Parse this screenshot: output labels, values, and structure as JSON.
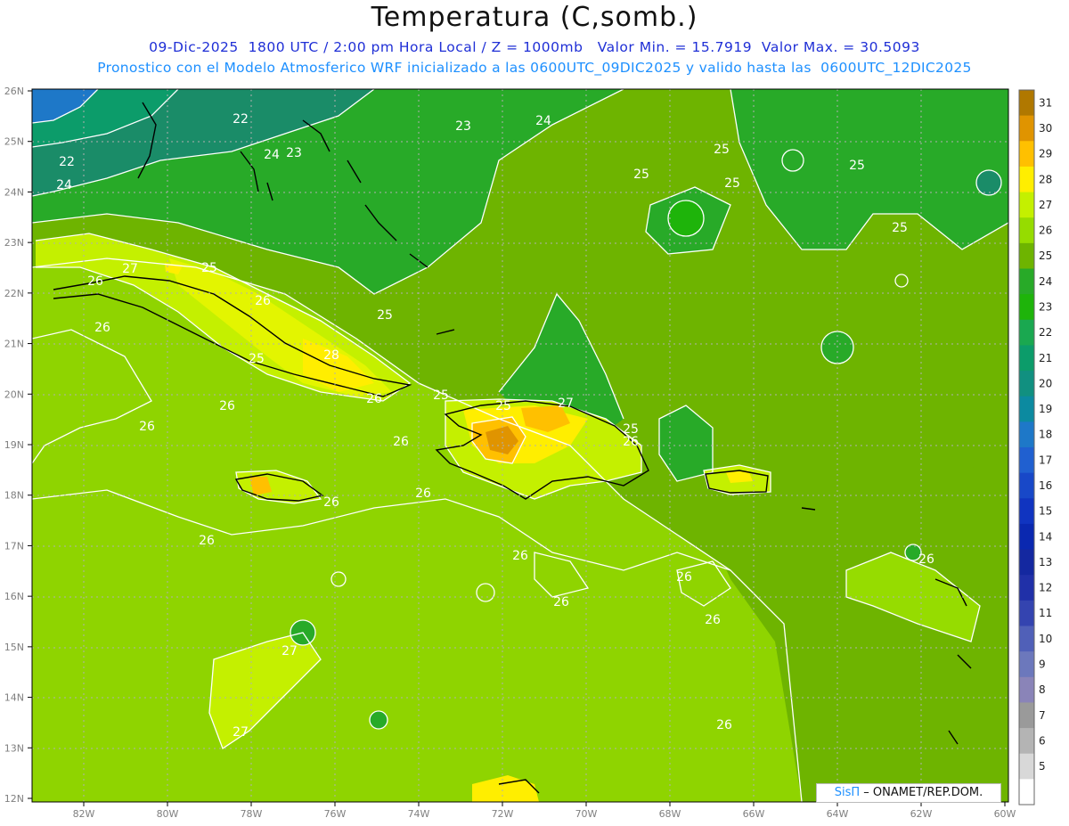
{
  "title": "Temperatura (C,somb.)",
  "subtitle_line1": "09-Dic-2025  1800 UTC / 2:00 pm Hora Local / Z = 1000mb   Valor Min. = 15.7919  Valor Max. = 30.5093",
  "subtitle_line2": "Pronostico con el Modelo Atmosferico WRF inicializado a las 0600UTC_09DIC2025 y valido hasta las  0600UTC_12DIC2025",
  "credit": {
    "logo": "SisΠ",
    "org": "– ONAMET/REP.DOM."
  },
  "axes": {
    "lat_labels": [
      "26N",
      "25N",
      "24N",
      "23N",
      "22N",
      "21N",
      "20N",
      "19N",
      "18N",
      "17N",
      "16N",
      "15N",
      "14N",
      "13N",
      "12N"
    ],
    "lon_labels": [
      "82W",
      "80W",
      "78W",
      "76W",
      "74W",
      "72W",
      "70W",
      "68W",
      "66W",
      "64W",
      "62W",
      "60W"
    ]
  },
  "colorbar": {
    "labels": [
      "31",
      "30",
      "29",
      "28",
      "27",
      "26",
      "25",
      "24",
      "23",
      "22",
      "21",
      "20",
      "19",
      "18",
      "17",
      "16",
      "15",
      "14",
      "13",
      "12",
      "11",
      "10",
      "9",
      "8",
      "7",
      "6",
      "5"
    ],
    "colors": [
      "#b07800",
      "#e09400",
      "#ffc000",
      "#ffee00",
      "#c4f000",
      "#96dc00",
      "#6eb400",
      "#28aa28",
      "#1eb40a",
      "#1aa850",
      "#0c9c6a",
      "#119080",
      "#0c8aa0",
      "#1e78c8",
      "#2060d0",
      "#1848c8",
      "#1034c0",
      "#0a28b0",
      "#1428a0",
      "#2030a8",
      "#3444b0",
      "#5060b8",
      "#6c78bc",
      "#8a84b8",
      "#9a9a9a",
      "#b4b4b4",
      "#d8d8d8",
      "#ffffff"
    ]
  },
  "isoline_labels": [
    "22",
    "22",
    "24",
    "23",
    "23",
    "24",
    "24",
    "25",
    "25",
    "25",
    "25",
    "25",
    "25",
    "25",
    "25",
    "25",
    "26",
    "27",
    "26",
    "26",
    "28",
    "25",
    "26",
    "26",
    "26",
    "26",
    "27",
    "25",
    "26",
    "26",
    "26",
    "26",
    "26",
    "26",
    "26",
    "26",
    "26",
    "27",
    "27",
    "26"
  ],
  "regions": {
    "ocean": "#8fd400",
    "north_atlantic": "#26a12c",
    "deep_cold": "#1a8c68",
    "bahamas": "#6eb400",
    "warm_land": "#ffee00",
    "hot_land": "#ffc000",
    "hottest": "#e09400"
  }
}
